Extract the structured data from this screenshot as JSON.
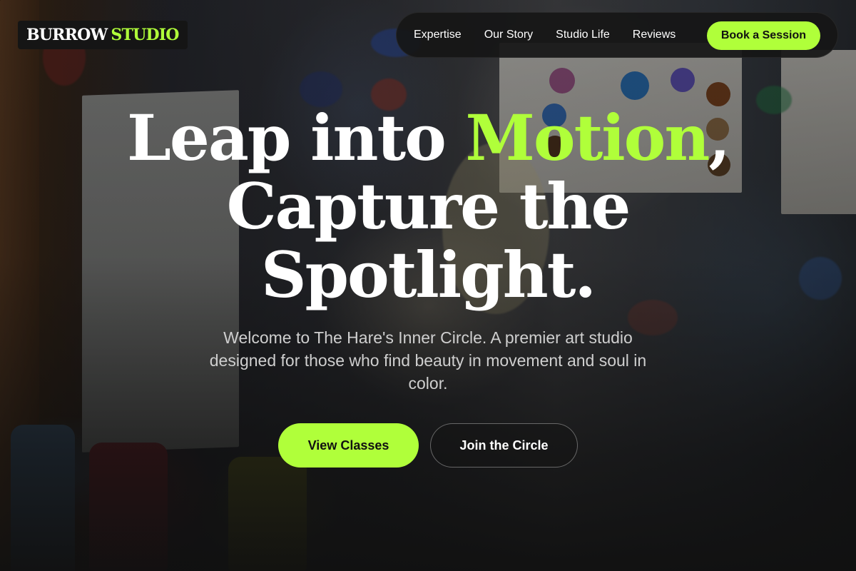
{
  "brand": {
    "name_part1": "BURROW",
    "name_part2": "STUDIO"
  },
  "nav": {
    "links": [
      "Expertise",
      "Our Story",
      "Studio Life",
      "Reviews"
    ],
    "cta_label": "Book a Session"
  },
  "hero": {
    "title_part1": "Leap into ",
    "title_highlight": "Motion",
    "title_part1_end": ",",
    "title_line2": "Capture the",
    "title_line3": "Spotlight.",
    "subtitle": "Welcome to The Hare's Inner Circle. A premier art studio designed for those who find beauty in movement and soul in color.",
    "primary_button": "View Classes",
    "secondary_button": "Join the Circle"
  },
  "colors": {
    "accent": "#b0ff3a",
    "nav_background": "#161616",
    "text": "#ffffff"
  }
}
